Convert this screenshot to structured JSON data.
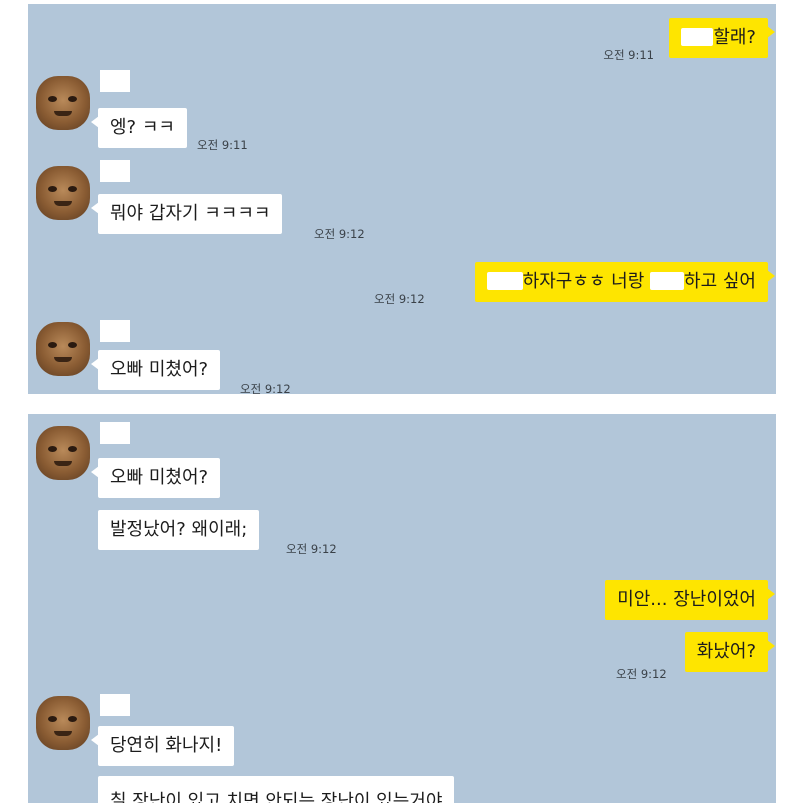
{
  "panel_top": {
    "messages": [
      {
        "text": "할래?",
        "time": "오전 9:11"
      },
      {
        "text": "엥? ㅋㅋ",
        "time": "오전 9:11"
      },
      {
        "text": "뭐야 갑자기 ㅋㅋㅋㅋ",
        "time": "오전 9:12"
      },
      {
        "text_a": "하자구ㅎㅎ 너랑 ",
        "text_b": "하고 싶어",
        "time": "오전 9:12"
      },
      {
        "text": "오빠 미쳤어?",
        "time": "오전 9:12"
      }
    ]
  },
  "panel_bottom": {
    "messages": [
      {
        "text": "오빠 미쳤어?"
      },
      {
        "text": "발정났어? 왜이래;",
        "time": "오전 9:12"
      },
      {
        "text": "미안... 장난이었어"
      },
      {
        "text": "화났어?",
        "time": "오전 9:12"
      },
      {
        "text": "당연히 화나지!"
      },
      {
        "text": "칠 장난이 있고 치면 안되는 장난이 있는거야"
      }
    ]
  },
  "colors": {
    "chat_background": "#b2c6d9",
    "outgoing_bubble": "#fee500",
    "incoming_bubble": "#ffffff"
  }
}
